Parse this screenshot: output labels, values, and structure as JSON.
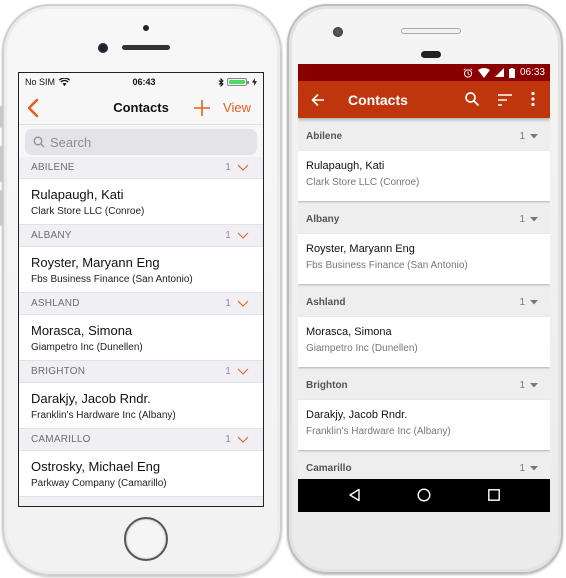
{
  "ios": {
    "status": {
      "carrier": "No SIM",
      "time": "06:43",
      "battery_percent": 100
    },
    "nav": {
      "title": "Contacts",
      "view_label": "View",
      "back_icon": "chevron-left-icon",
      "add_icon": "plus-icon"
    },
    "search": {
      "placeholder": "Search",
      "value": ""
    },
    "groups": [
      {
        "city": "ABILENE",
        "count": "1",
        "contact": {
          "name": "Rulapaugh, Kati",
          "company": "Clark Store LLC (Conroe)"
        }
      },
      {
        "city": "ALBANY",
        "count": "1",
        "contact": {
          "name": "Royster, Maryann Eng",
          "company": "Fbs Business Finance (San Antonio)"
        }
      },
      {
        "city": "ASHLAND",
        "count": "1",
        "contact": {
          "name": "Morasca, Simona",
          "company": "Giampetro Inc (Dunellen)"
        }
      },
      {
        "city": "BRIGHTON",
        "count": "1",
        "contact": {
          "name": "Darakjy, Jacob Rndr.",
          "company": "Franklin's Hardware Inc (Albany)"
        }
      },
      {
        "city": "CAMARILLO",
        "count": "1",
        "contact": {
          "name": "Ostrosky, Michael Eng",
          "company": "Parkway Company (Camarillo)"
        }
      }
    ],
    "accent_color": "#e4601c"
  },
  "android": {
    "status": {
      "time": "06:33"
    },
    "toolbar": {
      "title": "Contacts",
      "back_icon": "arrow-left-icon",
      "search_icon": "search-icon",
      "sort_icon": "sort-icon",
      "more_icon": "more-vert-icon"
    },
    "groups": [
      {
        "city": "Abilene",
        "count": "1",
        "contact": {
          "name": "Rulapaugh, Kati",
          "company": "Clark Store LLC (Conroe)"
        }
      },
      {
        "city": "Albany",
        "count": "1",
        "contact": {
          "name": "Royster, Maryann Eng",
          "company": "Fbs Business Finance (San Antonio)"
        }
      },
      {
        "city": "Ashland",
        "count": "1",
        "contact": {
          "name": "Morasca, Simona",
          "company": "Giampetro Inc (Dunellen)"
        }
      },
      {
        "city": "Brighton",
        "count": "1",
        "contact": {
          "name": "Darakjy, Jacob Rndr.",
          "company": "Franklin's Hardware Inc (Albany)"
        }
      },
      {
        "city": "Camarillo",
        "count": "1"
      }
    ],
    "colors": {
      "status_bar": "#8a0000",
      "toolbar": "#bf360c"
    }
  }
}
